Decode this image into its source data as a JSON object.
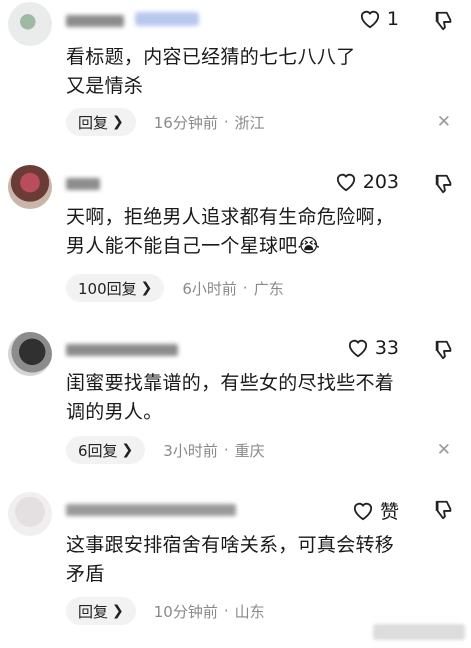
{
  "comments": [
    {
      "likes": "1",
      "text": "看标题，内容已经猜的七七八八了\n又是情杀",
      "reply_label": "回复",
      "time": "16分钟前",
      "location": "浙江"
    },
    {
      "likes": "203",
      "text": "天啊，拒绝男人追求都有生命危险啊，\n男人能不能自己一个星球吧😭",
      "reply_label": "100回复",
      "time": "6小时前",
      "location": "广东"
    },
    {
      "likes": "33",
      "text": "闺蜜要找靠谱的，有些女的尽找些不着\n调的男人。",
      "reply_label": "6回复",
      "time": "3小时前",
      "location": "重庆"
    },
    {
      "likes": "赞",
      "text": "这事跟安排宿舍有啥关系，可真会转移\n矛盾",
      "reply_label": "回复",
      "time": "10分钟前",
      "location": "山东"
    }
  ],
  "separator": "·",
  "icons": {
    "like": "heart-outline-icon",
    "dislike": "thumbs-down-icon",
    "close": "close-icon",
    "chevron": "chevron-right-icon"
  }
}
